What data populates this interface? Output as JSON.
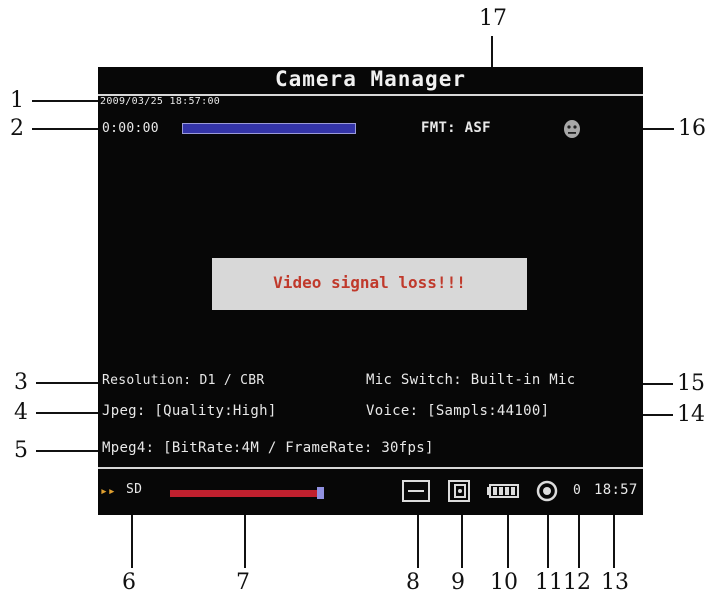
{
  "screen": {
    "title": "Camera Manager",
    "datetime": "2009/03/25 18:57:00",
    "elapsed": "0:00:00",
    "format": "FMT: ASF",
    "signal_message": "Video signal loss!!!",
    "resolution": "Resolution: D1  / CBR",
    "mic_switch": "Mic Switch: Built-in Mic",
    "jpeg": "Jpeg: [Quality:High]",
    "voice": "Voice: [Sampls:44100]",
    "mpeg4": "Mpeg4: [BitRate:4M / FrameRate: 30fps]",
    "colors": {
      "background": "#070707",
      "text": "#e8e8e8",
      "progress": "#3434a8",
      "volume": "#c0202e",
      "alert": "#c0392b"
    }
  },
  "status_bar": {
    "storage": "SD",
    "volume_level": 0.92,
    "counter": "0",
    "clock": "18:57",
    "icons": [
      "play-arrows-icon",
      "display-icon",
      "camera-icon",
      "battery-icon",
      "record-icon"
    ]
  },
  "callouts": [
    "1",
    "2",
    "3",
    "4",
    "5",
    "6",
    "7",
    "8",
    "9",
    "10",
    "11",
    "12",
    "13",
    "14",
    "15",
    "16",
    "17"
  ]
}
